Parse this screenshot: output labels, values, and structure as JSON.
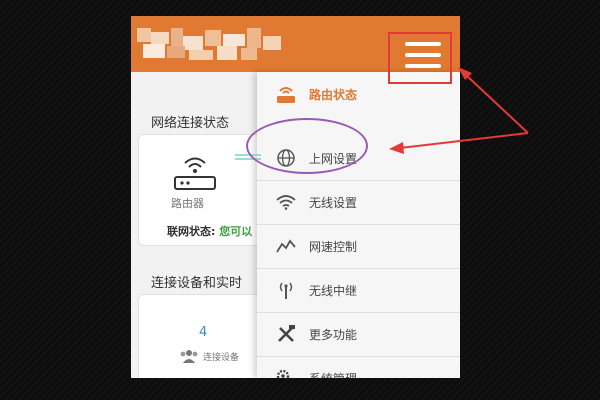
{
  "header": {
    "menu_icon": "hamburger-icon",
    "accent_color": "#e07a32"
  },
  "sections": {
    "network_status_title": "网络连接状态",
    "devices_title": "连接设备和实时"
  },
  "status_card": {
    "router_label": "路由器",
    "link_status_label": "联网状态:",
    "link_status_value": "您可以"
  },
  "devices_card": {
    "count": "4",
    "label": "连接设备"
  },
  "menu": {
    "items": [
      {
        "label": "路由状态",
        "icon": "router-icon"
      },
      {
        "label": "上网设置",
        "icon": "globe-icon"
      },
      {
        "label": "无线设置",
        "icon": "wifi-icon"
      },
      {
        "label": "网速控制",
        "icon": "speed-chart-icon"
      },
      {
        "label": "无线中继",
        "icon": "antenna-icon"
      },
      {
        "label": "更多功能",
        "icon": "tools-icon"
      },
      {
        "label": "系统管理",
        "icon": "gears-icon"
      }
    ]
  },
  "colors": {
    "highlight_ellipse": "#9b59b6",
    "highlight_box": "#e53935",
    "status_ok": "#3aa040"
  }
}
